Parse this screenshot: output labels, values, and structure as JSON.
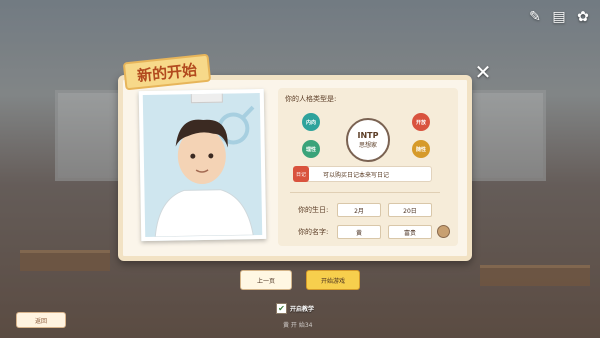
{
  "header": {
    "title": "新的开始"
  },
  "top_icons": [
    "brush-icon",
    "book-icon",
    "flower-icon"
  ],
  "personality": {
    "label": "你的人格类型是:",
    "type": "INTP",
    "type_name": "思想家",
    "traits": [
      "内向",
      "开放",
      "理性",
      "随性"
    ],
    "hint": "可以购买日记本来写日记",
    "hint_icon": "日记"
  },
  "birthday": {
    "label": "你的生日:",
    "month": "2月",
    "day": "20日"
  },
  "name": {
    "label": "你的名字:",
    "surname": "黄",
    "given": "富贵"
  },
  "buttons": {
    "prev": "上一页",
    "start": "开始游戏",
    "back": "返回"
  },
  "tutorial": {
    "label": "开启教学",
    "checked": true
  },
  "bottom_text": "黄 开 始34",
  "colors": {
    "accent": "#f7cf4d",
    "trait_intro": "#2fa39c",
    "trait_open": "#d9533e",
    "trait_rational": "#3aa37a",
    "trait_casual": "#d69a2a"
  }
}
